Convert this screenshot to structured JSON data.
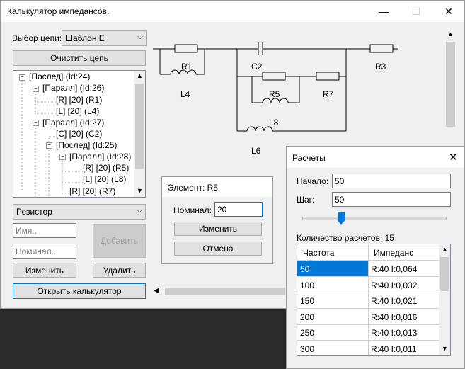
{
  "main_window": {
    "title": "Калькулятор импедансов.",
    "circuit_label": "Выбор цепи:",
    "circuit_value": "Шаблон Е",
    "clear_button": "Очистить цепь",
    "tree": [
      "[Послед] (Id:24)",
      "[Паралл] (Id:26)",
      "[R] [20] (R1)",
      "[L] [20] (L4)",
      "[Паралл] (Id:27)",
      "[C] [20] (C2)",
      "[Послед] (Id:25)",
      "[Паралл] (Id:28)",
      "[R] [20] (R5)",
      "[L] [20] (L8)",
      "[R] [20] (R7)"
    ],
    "element_type": "Резистор",
    "name_placeholder": "Имя..",
    "value_placeholder": "Номинал..",
    "add_button": "Добавить",
    "edit_button": "Изменить",
    "delete_button": "Удалить",
    "open_calc_button": "Открыть калькулятор",
    "schematic_labels": {
      "r1": "R1",
      "l4": "L4",
      "c2": "C2",
      "r3": "R3",
      "r5": "R5",
      "r7": "R7",
      "l8": "L8",
      "l6": "L6"
    }
  },
  "element_dialog": {
    "title": "Элемент: R5",
    "value_label": "Номинал:",
    "value": "20",
    "edit_button": "Изменить",
    "cancel_button": "Отмена"
  },
  "calc_window": {
    "title": "Расчеты",
    "start_label": "Начало:",
    "start_value": "50",
    "step_label": "Шаг:",
    "step_value": "50",
    "count_text": "Количество расчетов: 15",
    "slider_level": 0.26,
    "columns": [
      "Частота",
      "Импеданс"
    ],
    "rows": [
      [
        "50",
        "R:40 I:0,064"
      ],
      [
        "100",
        "R:40 I:0,032"
      ],
      [
        "150",
        "R:40 I:0,021"
      ],
      [
        "200",
        "R:40 I:0,016"
      ],
      [
        "250",
        "R:40 I:0,013"
      ],
      [
        "300",
        "R:40 I:0,011"
      ]
    ]
  },
  "colors": {
    "accent": "#0078d7",
    "selection": "#0078d7",
    "window_bg": "#f0f0f0",
    "taskbar": "#2b2b2b"
  }
}
